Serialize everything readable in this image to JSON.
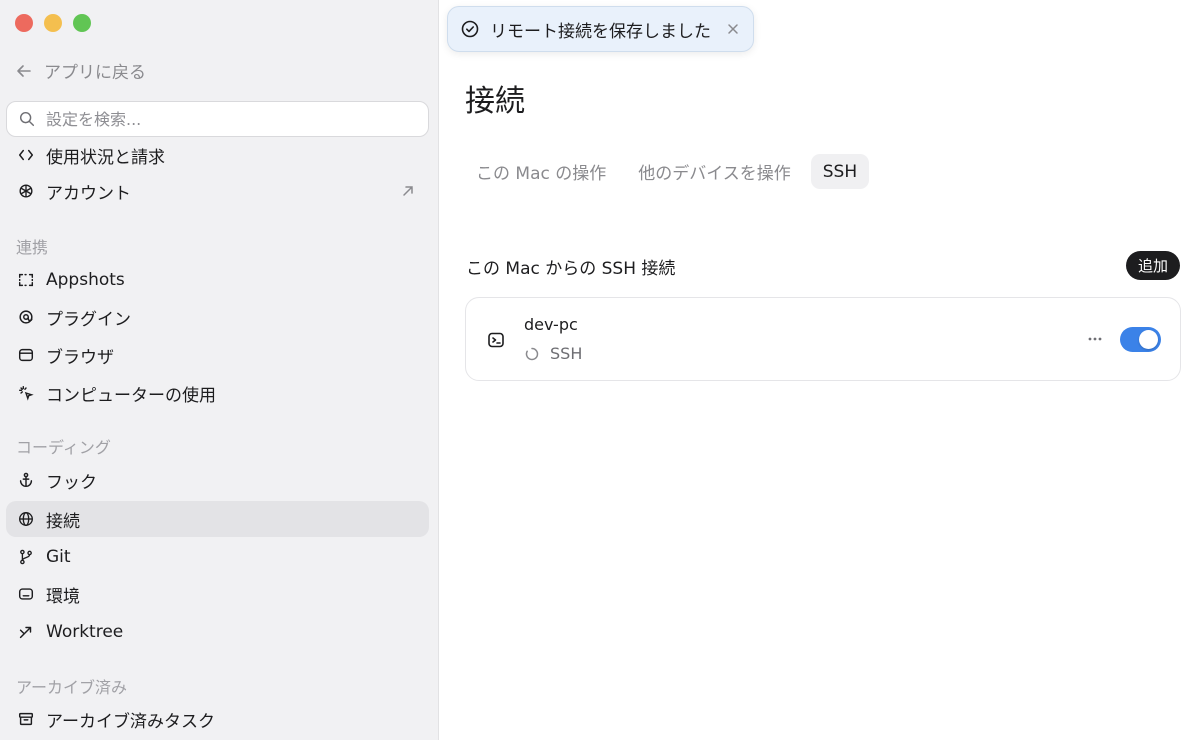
{
  "sidebar": {
    "back_label": "アプリに戻る",
    "search_placeholder": "設定を検索...",
    "top_items": [
      {
        "label": "使用状況と請求",
        "icon": "code-brackets-icon"
      },
      {
        "label": "アカウント",
        "icon": "openai-logo-icon",
        "trail_icon": "external-arrow-icon"
      }
    ],
    "sections": [
      {
        "title": "連携",
        "items": [
          {
            "label": "Appshots",
            "icon": "screenshot-frame-icon"
          },
          {
            "label": "プラグイン",
            "icon": "plugin-icon"
          },
          {
            "label": "ブラウザ",
            "icon": "browser-icon"
          },
          {
            "label": "コンピューターの使用",
            "icon": "cursor-click-icon"
          }
        ]
      },
      {
        "title": "コーディング",
        "items": [
          {
            "label": "フック",
            "icon": "anchor-icon"
          },
          {
            "label": "接続",
            "icon": "globe-icon",
            "active": true
          },
          {
            "label": "Git",
            "icon": "git-branch-icon"
          },
          {
            "label": "環境",
            "icon": "environment-icon"
          },
          {
            "label": "Worktree",
            "icon": "worktree-icon"
          }
        ]
      },
      {
        "title": "アーカイブ済み",
        "items": [
          {
            "label": "アーカイブ済みタスク",
            "icon": "archive-icon"
          }
        ]
      }
    ]
  },
  "toast": {
    "message": "リモート接続を保存しました",
    "icon": "check-circle-icon"
  },
  "main": {
    "title": "接続",
    "tabs": [
      {
        "label": "この Mac の操作"
      },
      {
        "label": "他のデバイスを操作"
      },
      {
        "label": "SSH",
        "active": true
      }
    ],
    "section_title": "この Mac からの SSH 接続",
    "add_label": "追加",
    "connections": [
      {
        "name": "dev-pc",
        "status": "SSH",
        "enabled": true
      }
    ]
  },
  "colors": {
    "accent": "#3b82e8",
    "sidebar_bg": "#f1f1f3",
    "toast_bg": "#e9f1fb"
  }
}
